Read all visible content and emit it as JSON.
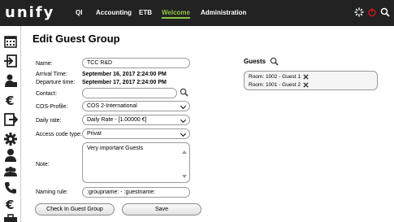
{
  "app": {
    "logo": "unify"
  },
  "nav": {
    "items": [
      {
        "label": "QI"
      },
      {
        "label": "Accounting"
      },
      {
        "label": "ETB"
      },
      {
        "label": "Welcome",
        "active": true
      },
      {
        "label": "Administration"
      }
    ],
    "accent_color": "#8dc63f"
  },
  "top_icons": [
    "spinner-icon",
    "power-icon",
    "search-icon"
  ],
  "sidebar_icons": [
    "calendar-icon",
    "check-in-icon",
    "person-icon",
    "euro-icon",
    "check-out-icon",
    "gear-icon",
    "user-icon",
    "group-icon",
    "phone-icon",
    "euro-icon",
    "briefcase-icon"
  ],
  "page": {
    "title": "Edit Guest Group"
  },
  "form": {
    "name_label": "Name:",
    "name_value": "TCC R&D",
    "arrival_label": "Arrival Time:",
    "arrival_value": "September 16, 2017 2:24:00 PM",
    "departure_label": "Departure time:",
    "departure_value": "September 17, 2017 2:24:00 PM",
    "contact_label": "Contact:",
    "contact_value": "",
    "cos_label": "COS-Profile:",
    "cos_value": "COS 2-International",
    "daily_label": "Daily rate:",
    "daily_value": "Daily Rate - [1.00000 €]",
    "access_label": "Access code type:",
    "access_value": "Privat",
    "note_label": "Note:",
    "note_value": "Very important Guests",
    "naming_label": "Naming rule:",
    "naming_value": ":groupname: - :guestname:"
  },
  "buttons": {
    "checkin": "Check In Guest Group",
    "save": "Save"
  },
  "guests": {
    "title": "Guests",
    "items": [
      {
        "label": "Room: 1002 - Guest 1"
      },
      {
        "label": "Room: 1001 - Guest 2"
      }
    ]
  }
}
